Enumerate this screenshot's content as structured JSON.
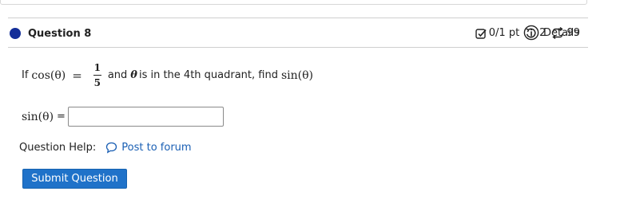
{
  "question": {
    "title": "Question 8"
  },
  "meta": {
    "score": "0/1 pt",
    "retries": "2",
    "attempts": "99",
    "details_label": "Details"
  },
  "problem": {
    "prefix": "If",
    "cos_expr": "cos(θ)",
    "equals": "=",
    "numerator": "1",
    "denominator": "5",
    "and_text": "and",
    "theta": "θ",
    "middle_text": "is in the 4th quadrant, find",
    "sin_expr": "sin(θ)"
  },
  "answer": {
    "label": "sin(θ)",
    "equals": "=",
    "value": ""
  },
  "help": {
    "label": "Question Help:",
    "forum_link": "Post to forum"
  },
  "submit": {
    "label": "Submit Question"
  },
  "colors": {
    "dot": "#132e99",
    "link": "#1a5fb4",
    "button": "#1f72c9"
  }
}
